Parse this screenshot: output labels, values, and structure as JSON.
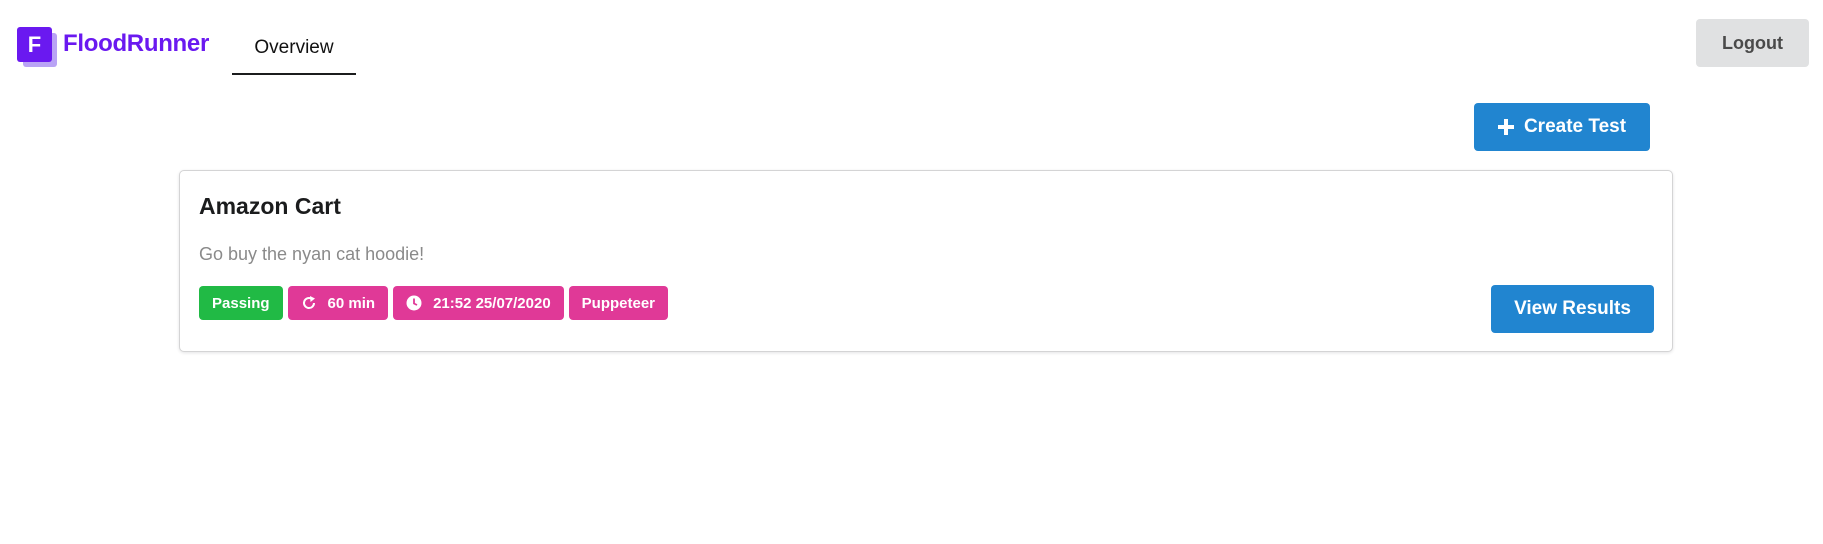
{
  "brand": {
    "logo_letter": "F",
    "name": "FloodRunner",
    "color": "#6a19f0"
  },
  "nav": {
    "tabs": [
      {
        "label": "Overview",
        "active": true
      }
    ],
    "logout_label": "Logout"
  },
  "toolbar": {
    "create_label": "Create Test",
    "create_icon": "plus-icon"
  },
  "tests": [
    {
      "title": "Amazon Cart",
      "description": "Go buy the nyan cat hoodie!",
      "status": "Passing",
      "interval": "60 min",
      "interval_icon": "redo-icon",
      "last_run": "21:52 25/07/2020",
      "last_run_icon": "clock-icon",
      "framework": "Puppeteer",
      "view_label": "View Results"
    }
  ],
  "colors": {
    "primary": "#2185d0",
    "passing": "#21ba45",
    "tag": "#e03997",
    "logout_bg": "#e0e1e2"
  }
}
